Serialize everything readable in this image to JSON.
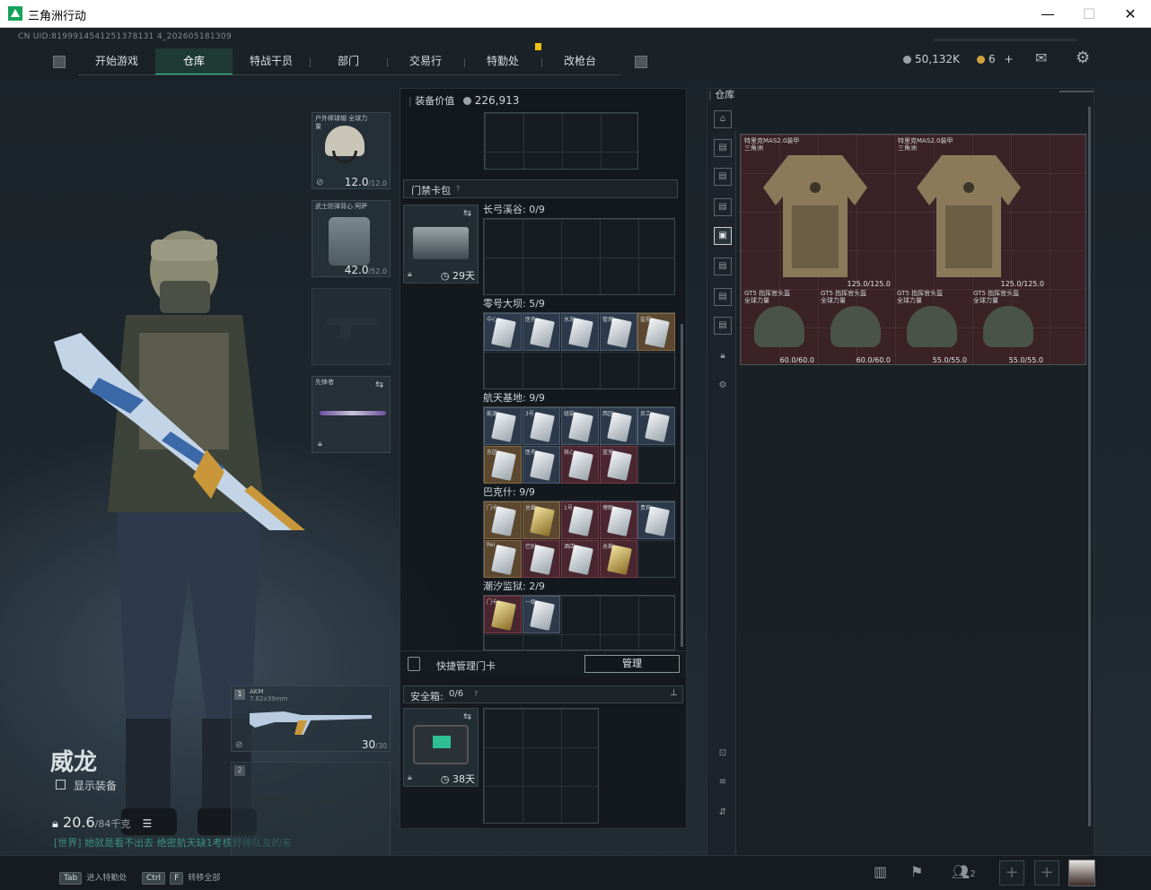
{
  "window": {
    "title": "三角洲行动",
    "controls": {
      "minimize": "—",
      "maximize": "☐",
      "close": "✕"
    }
  },
  "uid": "CN UID:8199914541251378131 4_202605181309",
  "nav": {
    "tabs": [
      {
        "label": "开始游戏",
        "active": false
      },
      {
        "label": "仓库",
        "active": true
      },
      {
        "label": "特战干员",
        "active": false
      },
      {
        "label": "部门",
        "active": false
      },
      {
        "label": "交易行",
        "active": false
      },
      {
        "label": "特勤处",
        "active": false
      },
      {
        "label": "改枪台",
        "active": false
      }
    ]
  },
  "currency": {
    "coins": "50,132K",
    "tickets": "6",
    "plus": "+"
  },
  "character": {
    "name": "威龙",
    "show_equipment_label": "显示装备",
    "weight_current": "20.6",
    "weight_max": "/84千克",
    "chat_message": "[世界] 她就是看不出去 绝密航天缺1考核野排队友的来"
  },
  "gear": {
    "helmet": {
      "label": "户外棒球帽 全球力量",
      "value": "12.0",
      "max": "/12.0"
    },
    "armor": {
      "label": "武士防弹背心 阿萨",
      "value": "42.0",
      "max": "/52.0"
    },
    "melee": {
      "label": "先锋者"
    },
    "primary": {
      "name": "AKM",
      "caliber": "7.62x39mm",
      "slot": "1",
      "ammo": "30",
      "ammo_max": "/30"
    },
    "secondary": {
      "slot": "2"
    }
  },
  "middle": {
    "equipment_value_label": "装备价值",
    "equipment_value": "226,913",
    "keycard_pack_label": "门禁卡包",
    "keycard_days": "29天",
    "sections": [
      {
        "title": "长弓溪谷: 0/9"
      },
      {
        "title": "零号大坝: 5/9"
      },
      {
        "title": "航天基地: 9/9"
      },
      {
        "title": "巴克什: 9/9"
      },
      {
        "title": "潮汐监狱: 2/9"
      }
    ],
    "quick_manage_label": "快捷管理门卡",
    "manage_button": "管理",
    "safe_box_label": "安全箱:",
    "safe_box_count": "0/6",
    "safe_box_days": "38天"
  },
  "warehouse": {
    "title": "仓库",
    "armors": [
      {
        "label": "特里克MAS2.0装甲 三角洲",
        "value": "125.0/125.0"
      },
      {
        "label": "特里克MAS2.0装甲 三角洲",
        "value": "125.0/125.0"
      }
    ],
    "helmets": [
      {
        "label": "GT5 指挥官头盔 全球力量",
        "value": "60.0/60.0"
      },
      {
        "label": "GT5 指挥官头盔 全球力量",
        "value": "60.0/60.0"
      },
      {
        "label": "GT5 指挥官头盔 全球力量",
        "value": "55.0/55.0"
      },
      {
        "label": "GT5 指挥官头盔 全球力量",
        "value": "55.0/55.0"
      }
    ]
  },
  "bottom": {
    "tab_key": "Tab",
    "tab_label": "进入特勤处",
    "ctrl_key": "Ctrl",
    "f_key": "F",
    "ctrl_label": "转移全部",
    "team_count": "2"
  }
}
